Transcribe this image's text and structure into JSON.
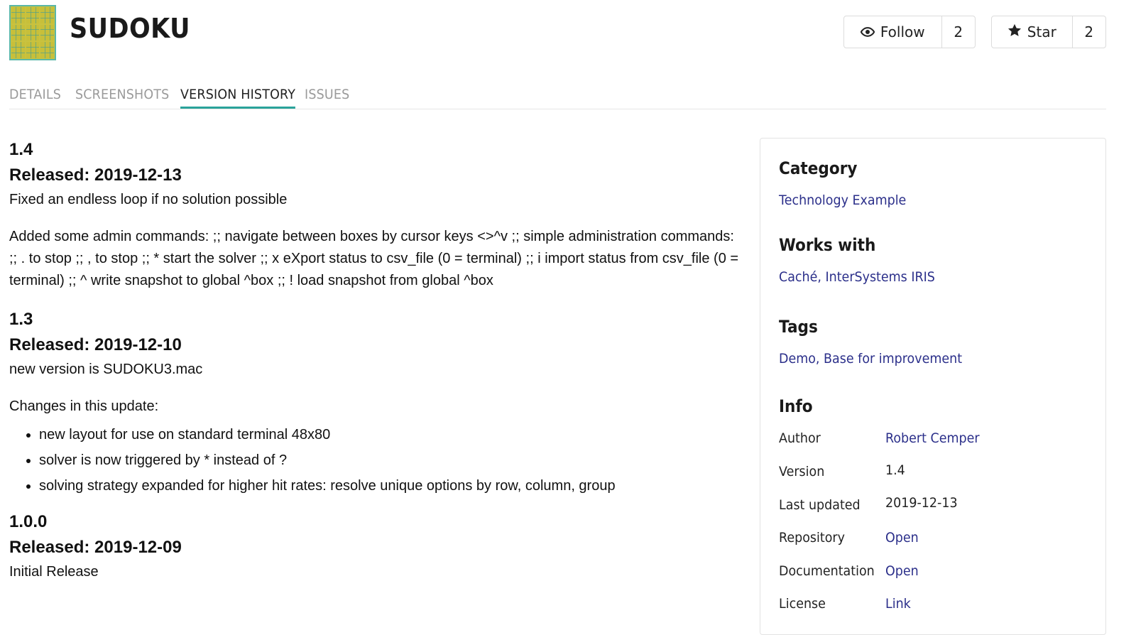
{
  "header": {
    "title": "SUDOKU",
    "follow": {
      "label": "Follow",
      "count": "2"
    },
    "star": {
      "label": "Star",
      "count": "2"
    }
  },
  "tabs": [
    {
      "label": "DETAILS",
      "active": false
    },
    {
      "label": "SCREENSHOTS",
      "active": false
    },
    {
      "label": "VERSION HISTORY",
      "active": true
    },
    {
      "label": "ISSUES",
      "active": false
    }
  ],
  "versions": [
    {
      "version": "1.4",
      "released": "Released: 2019-12-13",
      "paragraphs": [
        "Fixed an endless loop if no solution possible",
        "Added some admin commands: ;; navigate between boxes by cursor keys <>^v ;; simple administration commands: ;; . to stop ;; , to stop ;; * start the solver ;; x eXport status to csv_file (0 = terminal) ;; i import status from csv_file (0 = terminal) ;; ^ write snapshot to global ^box ;; ! load snapshot from global ^box"
      ]
    },
    {
      "version": "1.3",
      "released": "Released: 2019-12-10",
      "paragraphs": [
        "new version is SUDOKU3.mac",
        "Changes in this update:"
      ],
      "bullets": [
        "new layout for use on standard terminal 48x80",
        "solver is now triggered by * instead of ?",
        "solving strategy expanded for higher hit rates: resolve unique options by row, column, group"
      ]
    },
    {
      "version": "1.0.0",
      "released": "Released: 2019-12-09",
      "paragraphs": [
        "Initial Release"
      ]
    }
  ],
  "sidebar": {
    "category": {
      "heading": "Category",
      "value": "Technology Example"
    },
    "works_with": {
      "heading": "Works with",
      "value": "Caché, InterSystems IRIS"
    },
    "tags": {
      "heading": "Tags",
      "value": "Demo, Base for improvement"
    },
    "info": {
      "heading": "Info",
      "rows": [
        {
          "label": "Author",
          "value": "Robert Cemper",
          "link": true
        },
        {
          "label": "Version",
          "value": "1.4",
          "link": false
        },
        {
          "label": "Last updated",
          "value": "2019-12-13",
          "link": false
        },
        {
          "label": "Repository",
          "value": "Open",
          "link": true
        },
        {
          "label": "Documentation",
          "value": "Open",
          "link": true
        },
        {
          "label": "License",
          "value": "Link",
          "link": true
        }
      ]
    }
  },
  "colors": {
    "accent": "#2aa39a",
    "link": "#2b2f8a"
  },
  "icons": {
    "follow": "eye-icon",
    "star": "star-icon"
  }
}
